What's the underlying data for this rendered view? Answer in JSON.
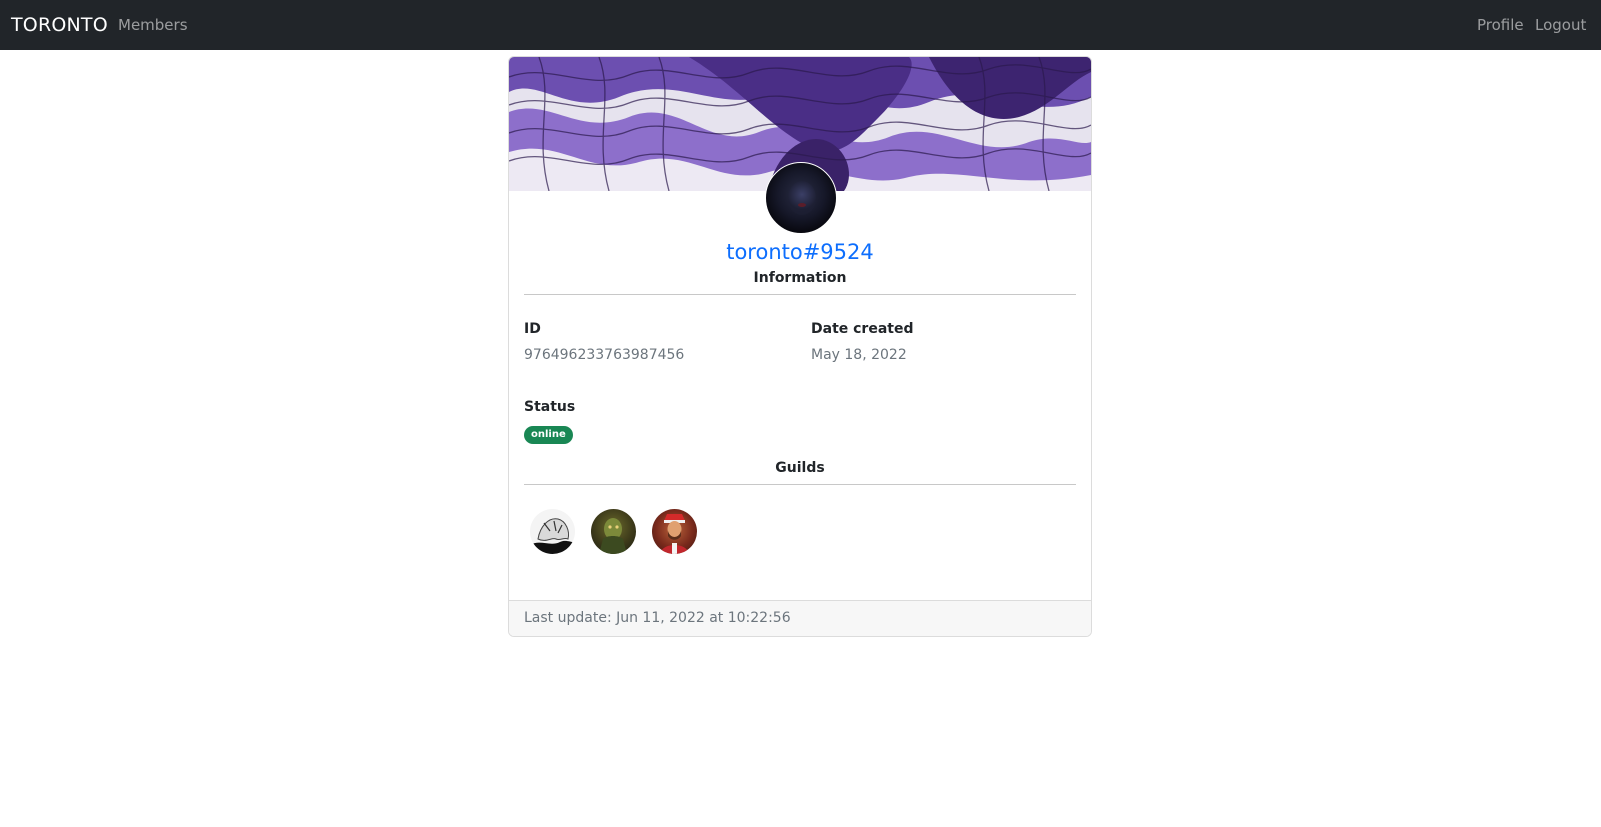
{
  "navbar": {
    "brand": "TORONTO",
    "links": {
      "members": "Members",
      "profile": "Profile",
      "logout": "Logout"
    }
  },
  "profile": {
    "username": "toronto#9524",
    "information_title": "Information",
    "fields": {
      "id_label": "ID",
      "id_value": "976496233763987456",
      "date_label": "Date created",
      "date_value": "May 18, 2022",
      "status_label": "Status",
      "status_value": "online"
    },
    "guilds_title": "Guilds",
    "guild_count": 3,
    "footer": "Last update: Jun 11, 2022 at 10:22:56"
  },
  "colors": {
    "navbar_bg": "#212529",
    "link": "#0d6efd",
    "status_online": "#198754",
    "banner_purple": "#6c4fb0"
  }
}
